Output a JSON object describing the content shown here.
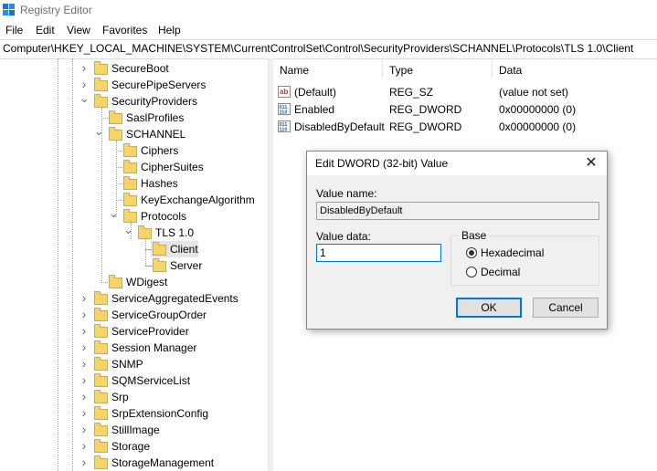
{
  "window": {
    "title": "Registry Editor",
    "icon": "registry-editor-icon"
  },
  "menu": {
    "items": [
      "File",
      "Edit",
      "View",
      "Favorites",
      "Help"
    ]
  },
  "address": {
    "path": "Computer\\HKEY_LOCAL_MACHINE\\SYSTEM\\CurrentControlSet\\Control\\SecurityProviders\\SCHANNEL\\Protocols\\TLS 1.0\\Client"
  },
  "tree": {
    "items": [
      {
        "label": "SecureBoot",
        "expander": "collapsed"
      },
      {
        "label": "SecurePipeServers",
        "expander": "collapsed"
      },
      {
        "label": "SecurityProviders",
        "expander": "expanded"
      },
      {
        "label": "SaslProfiles",
        "expander": "none"
      },
      {
        "label": "SCHANNEL",
        "expander": "expanded"
      },
      {
        "label": "Ciphers",
        "expander": "none"
      },
      {
        "label": "CipherSuites",
        "expander": "none"
      },
      {
        "label": "Hashes",
        "expander": "none"
      },
      {
        "label": "KeyExchangeAlgorithm",
        "expander": "none"
      },
      {
        "label": "Protocols",
        "expander": "expanded"
      },
      {
        "label": "TLS 1.0",
        "expander": "expanded"
      },
      {
        "label": "Client",
        "expander": "none",
        "selected": true
      },
      {
        "label": "Server",
        "expander": "none"
      },
      {
        "label": "WDigest",
        "expander": "none"
      },
      {
        "label": "ServiceAggregatedEvents",
        "expander": "collapsed"
      },
      {
        "label": "ServiceGroupOrder",
        "expander": "collapsed"
      },
      {
        "label": "ServiceProvider",
        "expander": "collapsed"
      },
      {
        "label": "Session Manager",
        "expander": "collapsed"
      },
      {
        "label": "SNMP",
        "expander": "collapsed"
      },
      {
        "label": "SQMServiceList",
        "expander": "collapsed"
      },
      {
        "label": "Srp",
        "expander": "collapsed"
      },
      {
        "label": "SrpExtensionConfig",
        "expander": "collapsed"
      },
      {
        "label": "StillImage",
        "expander": "collapsed"
      },
      {
        "label": "Storage",
        "expander": "collapsed"
      },
      {
        "label": "StorageManagement",
        "expander": "collapsed"
      }
    ]
  },
  "list": {
    "columns": [
      "Name",
      "Type",
      "Data"
    ],
    "rows": [
      {
        "name": "(Default)",
        "type": "REG_SZ",
        "data": "(value not set)",
        "icon": "string-value-icon"
      },
      {
        "name": "Enabled",
        "type": "REG_DWORD",
        "data": "0x00000000 (0)",
        "icon": "binary-value-icon"
      },
      {
        "name": "DisabledByDefault",
        "type": "REG_DWORD",
        "data": "0x00000000 (0)",
        "icon": "binary-value-icon"
      }
    ]
  },
  "dialog": {
    "title": "Edit DWORD (32-bit) Value",
    "value_name_label": "Value name:",
    "value_name": "DisabledByDefault",
    "value_data_label": "Value data:",
    "value_data": "1",
    "base_label": "Base",
    "hex_label": "Hexadecimal",
    "dec_label": "Decimal",
    "selected_base": "Hexadecimal",
    "ok_label": "OK",
    "cancel_label": "Cancel"
  },
  "colors": {
    "accent": "#0078d7",
    "folder": "#f5d469",
    "selection": "#e5e5e5",
    "dialog_bg": "#f0f0f0"
  }
}
